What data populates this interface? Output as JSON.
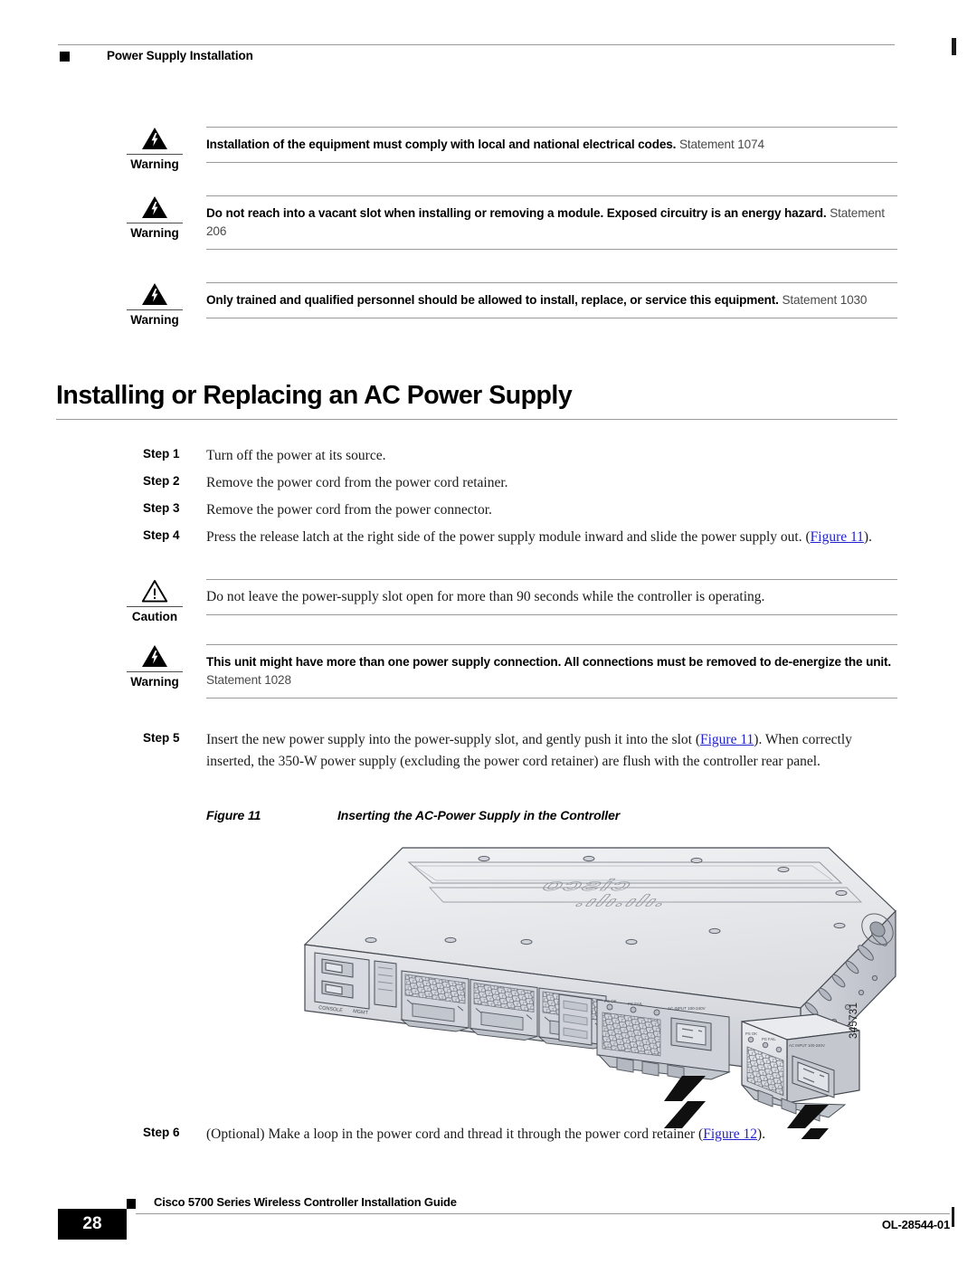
{
  "header": {
    "title": "Power Supply Installation"
  },
  "admonitions": [
    {
      "label": "Warning",
      "icon": "warning-lightning-triangle-icon",
      "bold_text": "Installation of the equipment must comply with local and national electrical codes.",
      "statement": "Statement 1074"
    },
    {
      "label": "Warning",
      "icon": "warning-lightning-triangle-icon",
      "bold_text": "Do not reach into a vacant slot when installing or removing a module. Exposed circuitry is an energy hazard.",
      "statement": "Statement 206"
    },
    {
      "label": "Warning",
      "icon": "warning-lightning-triangle-icon",
      "bold_text": "Only trained and qualified personnel should be allowed to install, replace, or service this equipment.",
      "statement": "Statement 1030"
    }
  ],
  "section": {
    "heading": "Installing or Replacing an AC Power Supply"
  },
  "steps": [
    {
      "number": "Step 1",
      "text": "Turn off the power at its source."
    },
    {
      "number": "Step 2",
      "text": "Remove the power cord from the power cord retainer."
    },
    {
      "number": "Step 3",
      "text": "Remove the power cord from the power connector."
    },
    {
      "number": "Step 4",
      "text_before": "Press the release latch at the right side of the power supply module inward and slide the power supply out. (",
      "xref": "Figure 11",
      "text_after": ")."
    },
    {
      "number": "Step 5",
      "text_before": "Insert the new power supply into the power-supply slot, and gently push it into the slot (",
      "xref": "Figure 11",
      "text_after": "). When correctly inserted, the 350-W power supply (excluding the power cord retainer) are flush with the controller rear panel."
    },
    {
      "number": "Step 6",
      "text_before": "(Optional) Make a loop in the power cord and thread it through the power cord retainer (",
      "xref": "Figure 12",
      "text_after": ")."
    }
  ],
  "caution": {
    "label": "Caution",
    "icon": "caution-exclamation-triangle-icon",
    "text": "Do not leave the power-supply slot open for more than 90 seconds while the controller is operating."
  },
  "warning_power": {
    "label": "Warning",
    "icon": "warning-lightning-triangle-icon",
    "bold_text": "This unit might have more than one power supply connection. All connections must be removed to de-energize the unit.",
    "statement": "Statement 1028"
  },
  "figure": {
    "label": "Figure 11",
    "caption": "Inserting the AC-Power Supply in the Controller",
    "art_id": "345731",
    "art_alt": "Line drawing of a Cisco 5700 series controller rear view with an AC power supply module being inserted into the power supply slot, black arrows showing insertion direction"
  },
  "footer": {
    "page_number": "28",
    "guide_title": "Cisco 5700 Series Wireless Controller Installation Guide",
    "doc_id": "OL-28544-01"
  },
  "colors": {
    "xref_link": "#2222cc",
    "rule": "#9a9a9a",
    "text": "#1a1a1a"
  }
}
